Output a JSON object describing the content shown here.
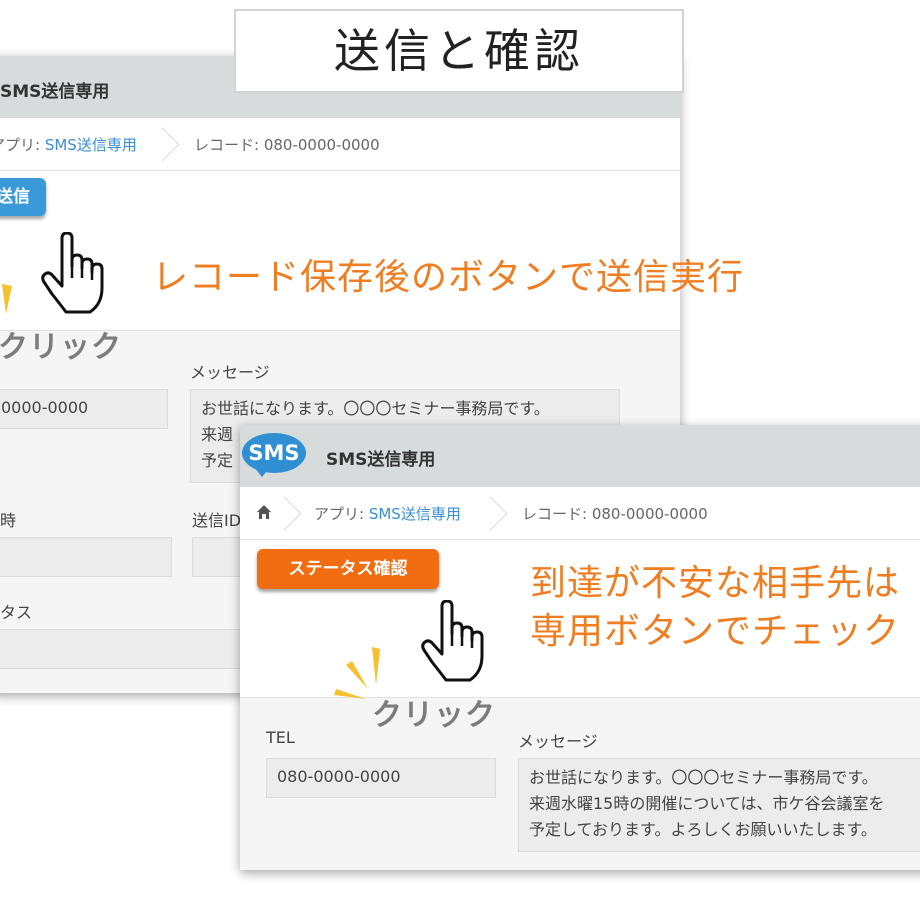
{
  "title": "送信と確認",
  "panel1": {
    "header_title": "SMS送信専用",
    "breadcrumb": {
      "app_prefix": "アプリ: ",
      "app_name": "SMS送信専用",
      "record": "レコード: 080-0000-0000"
    },
    "send_button": "送信",
    "callout": "レコード保存後のボタンで送信実行",
    "click_label": "クリック",
    "fields": {
      "message_label": "メッセージ",
      "tel_value": "0000-0000",
      "message_line1": "お世話になります。〇〇〇セミナー事務局です。",
      "message_line2": "来週",
      "message_line3": "予定",
      "datetime_label": "時",
      "send_id_label": "送信ID",
      "status_label": "タス"
    }
  },
  "panel2": {
    "logo_text": "SMS",
    "header_title": "SMS送信専用",
    "breadcrumb": {
      "app_prefix": "アプリ: ",
      "app_name": "SMS送信専用",
      "record": "レコード: 080-0000-0000"
    },
    "status_button": "ステータス確認",
    "callout_line1": "到達が不安な相手先は",
    "callout_line2": "専用ボタンでチェック",
    "click_label": "クリック",
    "fields": {
      "tel_label": "TEL",
      "tel_value": "080-0000-0000",
      "message_label": "メッセージ",
      "message_line1": "お世話になります。〇〇〇セミナー事務局です。",
      "message_line2": "来週水曜15時の開催については、市ケ谷会議室を",
      "message_line3": "予定しております。よろしくお願いいたします。"
    }
  },
  "colors": {
    "accent_orange": "#f26d12",
    "callout_orange": "#ef7d22",
    "link_blue": "#3a8ed5",
    "send_blue": "#3a9ad9",
    "spark_yellow": "#f6c12d"
  }
}
